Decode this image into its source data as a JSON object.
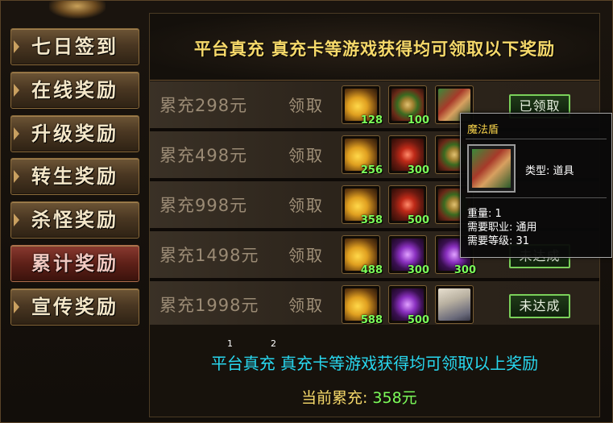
{
  "sidebar": {
    "items": [
      {
        "label": "七日签到",
        "active": false
      },
      {
        "label": "在线奖励",
        "active": false
      },
      {
        "label": "升级奖励",
        "active": false
      },
      {
        "label": "转生奖励",
        "active": false
      },
      {
        "label": "杀怪奖励",
        "active": false
      },
      {
        "label": "累计奖励",
        "active": true
      },
      {
        "label": "宣传奖励",
        "active": false
      }
    ]
  },
  "header": {
    "title": "平台真充 真充卡等游戏获得均可领取以下奖励"
  },
  "rows": [
    {
      "label": "累充298元",
      "claim": "领取",
      "items": [
        {
          "icon": "gold-ingot-icon",
          "qty": "128"
        },
        {
          "icon": "green-orb-icon",
          "qty": "100"
        },
        {
          "icon": "magic-shield-icon",
          "qty": ""
        }
      ],
      "status": "已领取"
    },
    {
      "label": "累充498元",
      "claim": "领取",
      "items": [
        {
          "icon": "gold-ingot-icon",
          "qty": "256"
        },
        {
          "icon": "red-orb-icon",
          "qty": "300"
        },
        {
          "icon": "green-orb-icon",
          "qty": ""
        }
      ],
      "status": ""
    },
    {
      "label": "累充998元",
      "claim": "领取",
      "items": [
        {
          "icon": "gold-ingot-icon",
          "qty": "358"
        },
        {
          "icon": "red-orb-icon",
          "qty": "500"
        },
        {
          "icon": "green-orb-icon",
          "qty": ""
        }
      ],
      "status": ""
    },
    {
      "label": "累充1498元",
      "claim": "领取",
      "items": [
        {
          "icon": "gold-ingot-icon",
          "qty": "488"
        },
        {
          "icon": "purple-orb-icon",
          "qty": "300"
        },
        {
          "icon": "purple-orb-icon",
          "qty": "300"
        }
      ],
      "status": "未达成"
    },
    {
      "label": "累充1998元",
      "claim": "领取",
      "items": [
        {
          "icon": "gold-ingot-icon",
          "qty": "588"
        },
        {
          "icon": "purple-orb-icon",
          "qty": "500"
        },
        {
          "icon": "sage-portrait-icon",
          "qty": ""
        }
      ],
      "status": "未达成"
    }
  ],
  "footer": {
    "text": "平台真充 真充卡等游戏获得均可领取以上奖励",
    "mini_1": "1",
    "mini_2": "2",
    "current_label": "当前累充:",
    "current_value": "358元"
  },
  "tooltip": {
    "title": "魔法盾",
    "type": "类型: 道具",
    "weight": "重量: 1",
    "job": "需要职业: 通用",
    "level": "需要等级: 31"
  },
  "colors": {
    "title_gold": "#f6d96a",
    "qty_green": "#7cff5a",
    "footer_cyan": "#28d8f0",
    "status_border": "#7ad05a"
  }
}
